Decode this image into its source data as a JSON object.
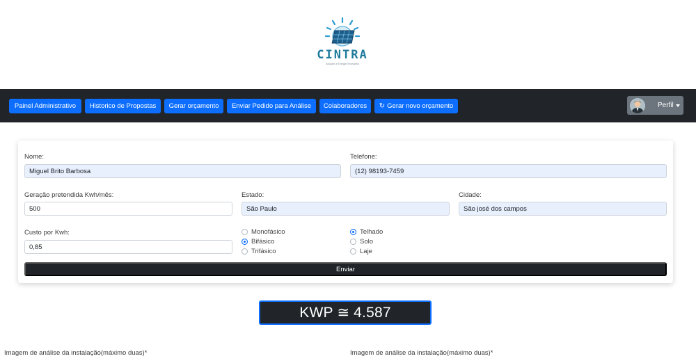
{
  "brand": {
    "name": "CINTRA",
    "tagline": "Soluções e Energia Renováveis"
  },
  "nav": {
    "items": [
      {
        "label": "Painel Administrativo"
      },
      {
        "label": "Historico de Propostas"
      },
      {
        "label": "Gerar orçamento"
      },
      {
        "label": "Enviar Pedido para Análise"
      },
      {
        "label": "Colaboradores"
      },
      {
        "label": "Gerar novo orçamento",
        "icon": "refresh-icon"
      }
    ],
    "profile_label": "Perfil"
  },
  "form": {
    "nome_label": "Nome:",
    "nome_value": "Miguel Brito Barbosa",
    "telefone_label": "Telefone:",
    "telefone_value": "(12) 98193-7459",
    "geracao_label": "Geração pretendida Kwh/mês:",
    "geracao_value": "500",
    "estado_label": "Estado:",
    "estado_value": "São Paulo",
    "cidade_label": "Cidade:",
    "cidade_value": "São josé dos campos",
    "custo_label": "Custo por Kwh:",
    "custo_value": "0,85",
    "fase_options": [
      {
        "label": "Monofásico",
        "checked": false
      },
      {
        "label": "Bifásico",
        "checked": true
      },
      {
        "label": "Trifásico",
        "checked": false
      }
    ],
    "local_options": [
      {
        "label": "Telhado",
        "checked": true
      },
      {
        "label": "Solo",
        "checked": false
      },
      {
        "label": "Laje",
        "checked": false
      }
    ],
    "submit_label": "Enviar"
  },
  "result": {
    "text": "KWP ≅ 4.587"
  },
  "uploads": {
    "left_label": "Imagem de análise da instalação(máximo duas)*",
    "right_label": "Imagem de análise da instalação(máximo duas)*"
  },
  "colors": {
    "accent": "#0d6efd",
    "dark": "#212529",
    "brand_teal": "#1f7a9c"
  }
}
